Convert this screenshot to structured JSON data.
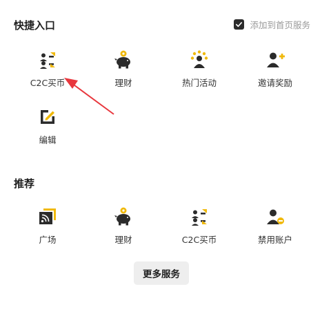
{
  "quick_entry": {
    "title": "快捷入口",
    "add_to_home_label": "添加到首页服务",
    "add_to_home_checked": true,
    "items": [
      {
        "label": "C2C买币",
        "icon": "c2c-users-icon"
      },
      {
        "label": "理财",
        "icon": "piggy-bank-icon"
      },
      {
        "label": "热门活动",
        "icon": "activity-group-icon"
      },
      {
        "label": "邀请奖励",
        "icon": "invite-user-icon"
      },
      {
        "label": "编辑",
        "icon": "edit-icon"
      }
    ]
  },
  "recommend": {
    "title": "推荐",
    "items": [
      {
        "label": "广场",
        "icon": "square-feed-icon"
      },
      {
        "label": "理财",
        "icon": "piggy-bank-icon"
      },
      {
        "label": "C2C买币",
        "icon": "c2c-users-icon"
      },
      {
        "label": "禁用账户",
        "icon": "disable-account-icon"
      }
    ]
  },
  "more_services_label": "更多服务",
  "colors": {
    "accent": "#F0B90B",
    "icon_dark": "#2B2B2B",
    "annotation_arrow": "#E8373D"
  }
}
